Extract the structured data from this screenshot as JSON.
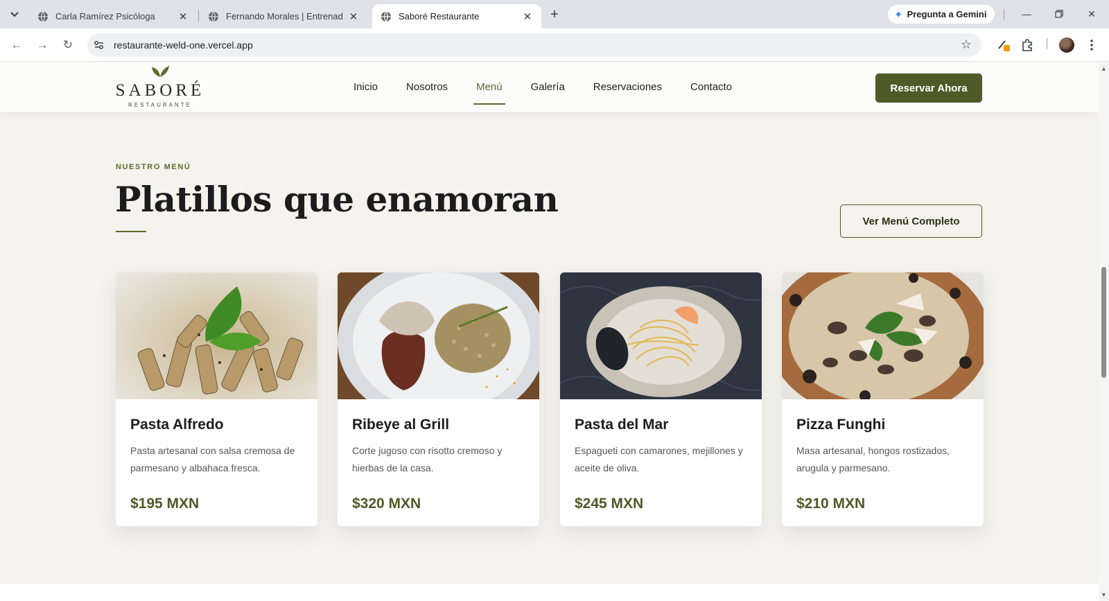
{
  "browser": {
    "tabs": [
      {
        "title": "Carla Ramírez Psicóloga",
        "active": false
      },
      {
        "title": "Fernando Morales | Entrenador",
        "active": false
      },
      {
        "title": "Saboré Restaurante",
        "active": true
      }
    ],
    "gemini_label": "Pregunta a Gemini",
    "url": "restaurante-weld-one.vercel.app"
  },
  "header": {
    "logo_name": "SABORÉ",
    "logo_sub": "RESTAURANTE",
    "nav": [
      {
        "label": "Inicio",
        "active": false
      },
      {
        "label": "Nosotros",
        "active": false
      },
      {
        "label": "Menú",
        "active": true
      },
      {
        "label": "Galería",
        "active": false
      },
      {
        "label": "Reservaciones",
        "active": false
      },
      {
        "label": "Contacto",
        "active": false
      }
    ],
    "cta_label": "Reservar Ahora"
  },
  "menu": {
    "eyebrow": "NUESTRO MENÚ",
    "title": "Platillos que enamoran",
    "full_menu_label": "Ver Menú Completo",
    "dishes": [
      {
        "name": "Pasta Alfredo",
        "description": "Pasta artesanal con salsa cremosa de parmesano y albahaca fresca.",
        "price": "$195 MXN"
      },
      {
        "name": "Ribeye al Grill",
        "description": "Corte jugoso con risotto cremoso y hierbas de la casa.",
        "price": "$320 MXN"
      },
      {
        "name": "Pasta del Mar",
        "description": "Espagueti con camarones, mejillones y aceite de oliva.",
        "price": "$245 MXN"
      },
      {
        "name": "Pizza Funghi",
        "description": "Masa artesanal, hongos rostizados, arugula y parmesano.",
        "price": "$210 MXN"
      }
    ]
  },
  "colors": {
    "accent": "#4e5a27",
    "accent_text": "#5b6b2e",
    "page_bg": "#f4f3ee"
  }
}
